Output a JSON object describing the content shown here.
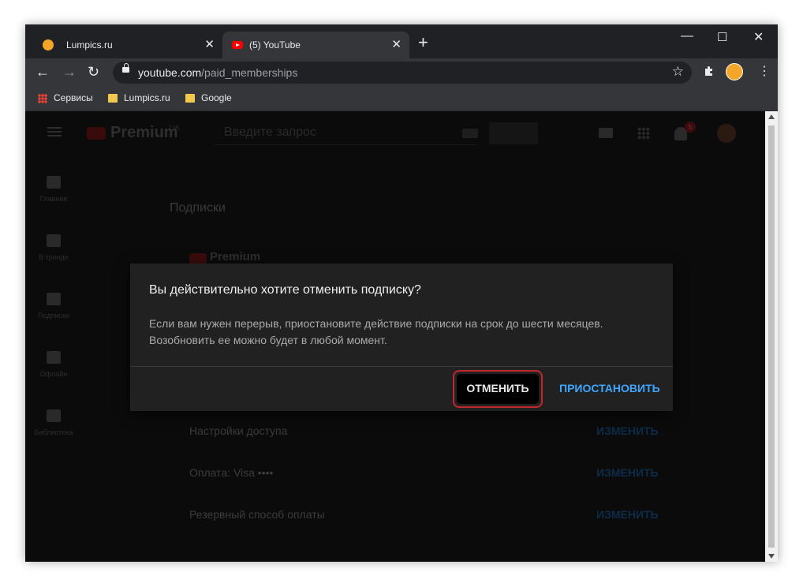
{
  "browser": {
    "tabs": [
      {
        "title": "Lumpics.ru",
        "close": "✕"
      },
      {
        "title": "(5) YouTube",
        "close": "✕"
      }
    ],
    "new_tab": "+",
    "window_controls": {
      "minimize": "—",
      "maximize": "☐",
      "close": "✕"
    },
    "nav": {
      "back": "←",
      "forward": "→",
      "reload": "↻"
    },
    "address": {
      "domain": "youtube.com",
      "path": "/paid_memberships"
    },
    "star": "☆",
    "extensions_icon": "puzzle-icon",
    "bookmarks": [
      {
        "label": "Сервисы",
        "icon": "apps-grid-icon"
      },
      {
        "label": "Lumpics.ru",
        "icon": "folder-icon"
      },
      {
        "label": "Google",
        "icon": "folder-icon"
      }
    ]
  },
  "youtube": {
    "brand": "Premium",
    "region": "UA",
    "search_placeholder": "Введите запрос",
    "notifications_count": "5",
    "sidebar": [
      {
        "label": "Главная"
      },
      {
        "label": "В тренде"
      },
      {
        "label": "Подписки"
      },
      {
        "label": "Офлайн"
      },
      {
        "label": "Библиотека"
      }
    ],
    "page_title": "Подписки",
    "membership_logo": "Premium",
    "rows": [
      {
        "label": "Настройки доступа",
        "action": "ИЗМЕНИТЬ"
      },
      {
        "label": "Оплата: Visa ••••",
        "action": "ИЗМЕНИТЬ"
      },
      {
        "label": "Резервный способ оплаты",
        "action": "ИЗМЕНИТЬ"
      }
    ]
  },
  "dialog": {
    "title": "Вы действительно хотите отменить подписку?",
    "body_line1": "Если вам нужен перерыв, приостановите действие подписки на срок до шести месяцев.",
    "body_line2": "Возобновить ее можно будет в любой момент.",
    "cancel_label": "ОТМЕНИТЬ",
    "pause_label": "ПРИОСТАНОВИТЬ"
  },
  "colors": {
    "accent_blue": "#3ea6ff",
    "highlight_red": "#c1272d",
    "dialog_bg": "#212121"
  }
}
